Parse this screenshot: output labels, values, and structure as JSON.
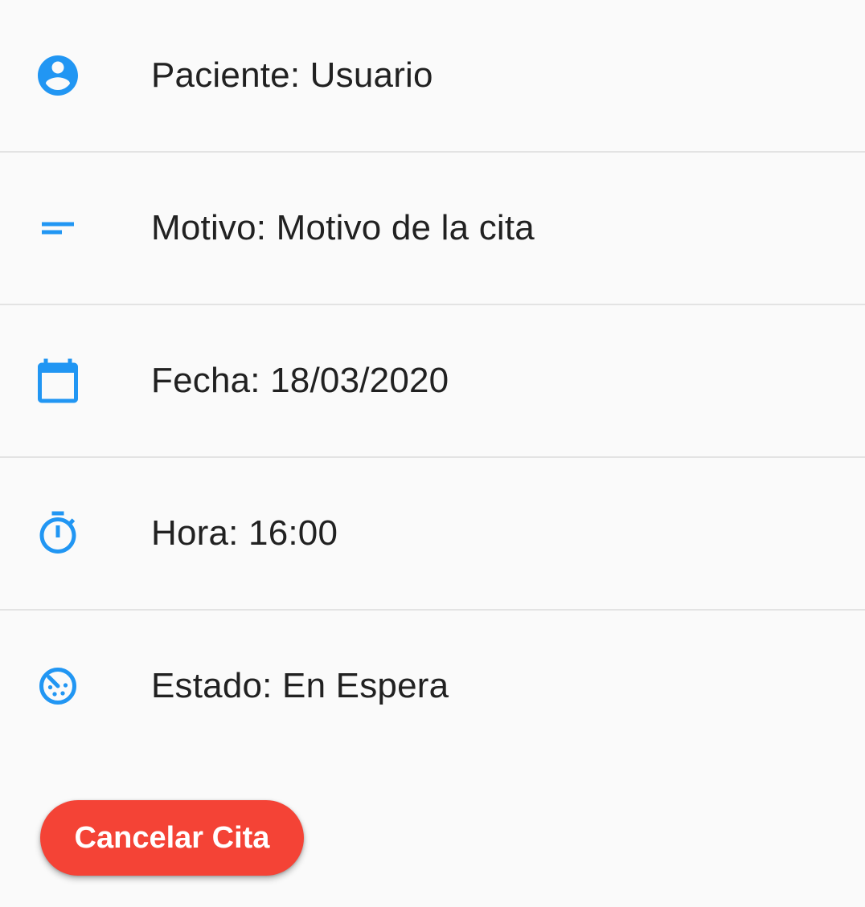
{
  "colors": {
    "background": "#fafafa",
    "icon_accent": "#2196f3",
    "divider": "#e3e3e3",
    "text": "#212121",
    "button_bg": "#f44336",
    "button_text": "#ffffff"
  },
  "details": [
    {
      "icon": "account-circle-icon",
      "label": "Paciente: Usuario"
    },
    {
      "icon": "short-text-icon",
      "label": "Motivo: Motivo de la cita"
    },
    {
      "icon": "calendar-icon",
      "label": "Fecha: 18/03/2020"
    },
    {
      "icon": "timer-icon",
      "label": "Hora: 16:00"
    },
    {
      "icon": "timelapse-off-icon",
      "label": "Estado: En Espera"
    }
  ],
  "actions": {
    "cancel_label": "Cancelar Cita"
  }
}
